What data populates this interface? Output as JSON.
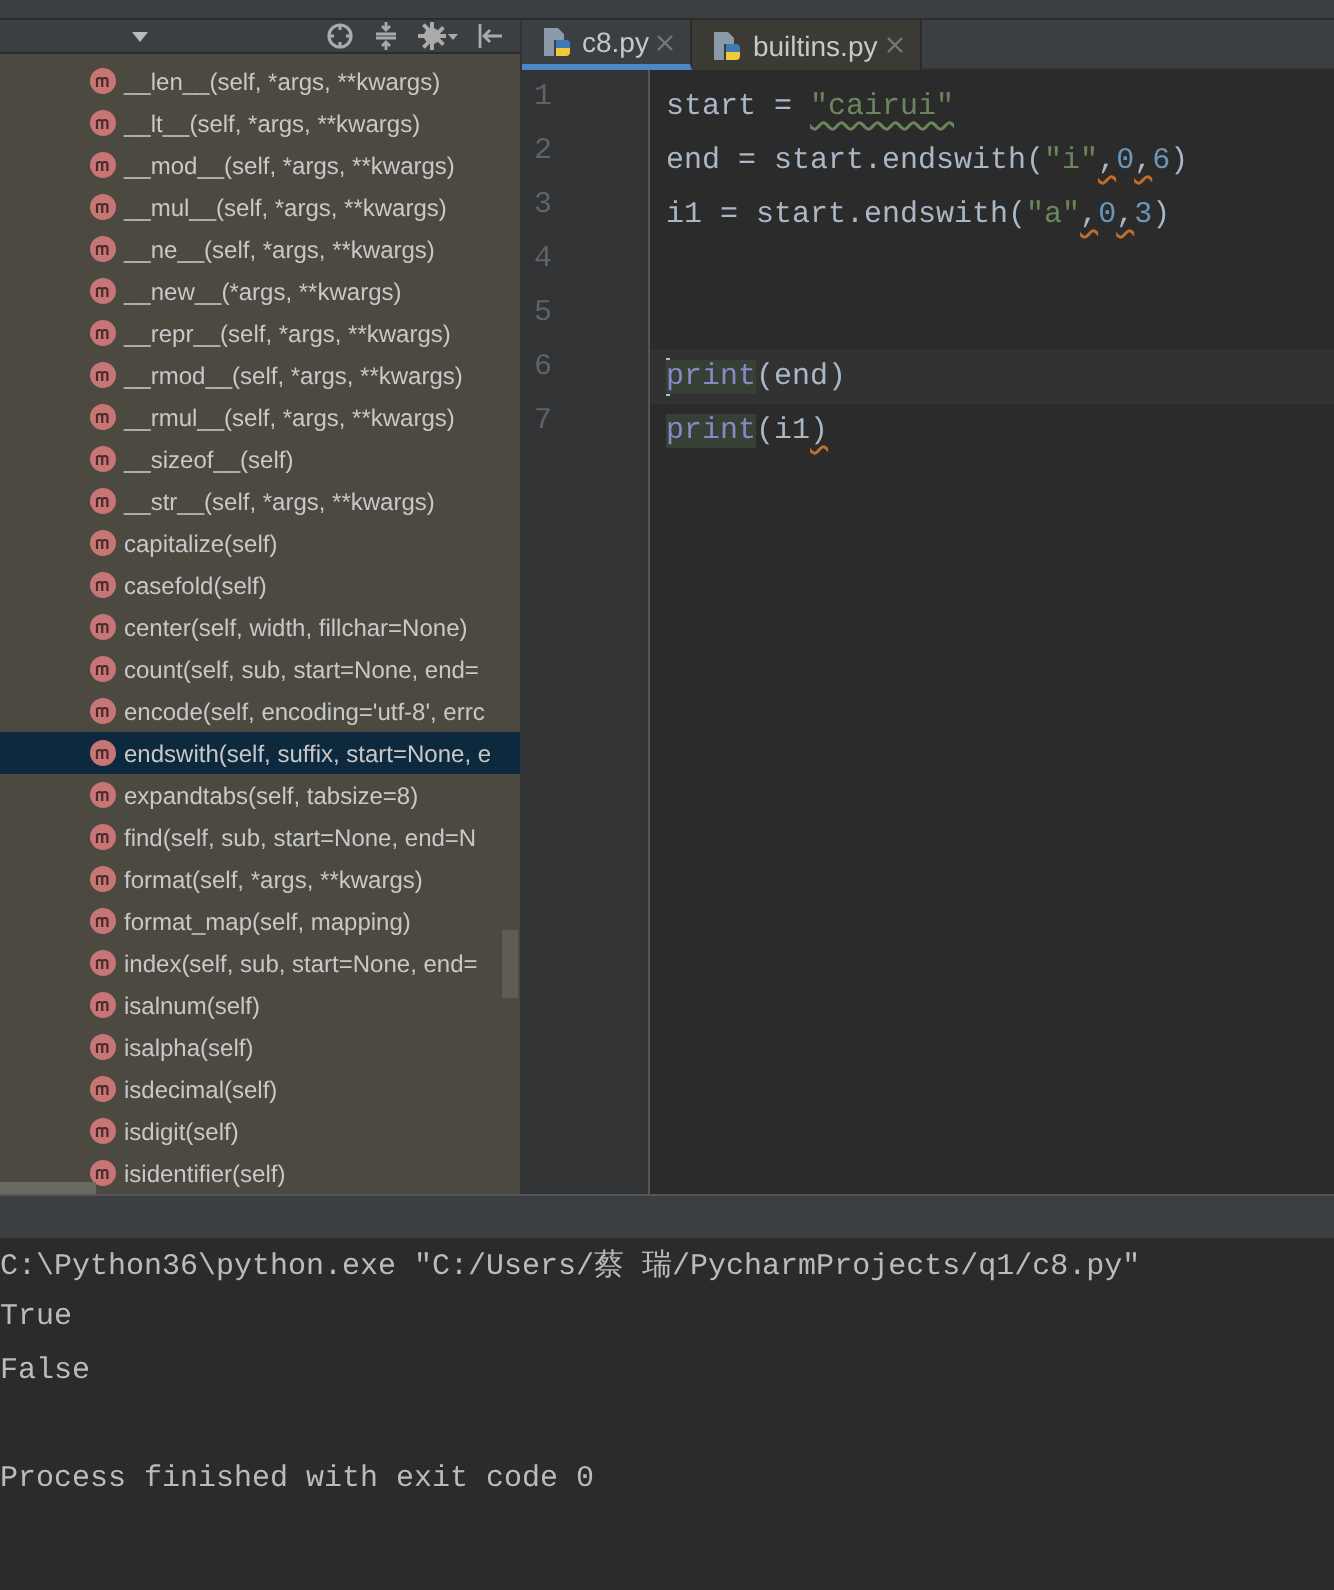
{
  "structure": {
    "methods": [
      {
        "label": "__len__(self, *args, **kwargs)",
        "selected": false
      },
      {
        "label": "__lt__(self, *args, **kwargs)",
        "selected": false
      },
      {
        "label": "__mod__(self, *args, **kwargs)",
        "selected": false
      },
      {
        "label": "__mul__(self, *args, **kwargs)",
        "selected": false
      },
      {
        "label": "__ne__(self, *args, **kwargs)",
        "selected": false
      },
      {
        "label": "__new__(*args, **kwargs)",
        "selected": false
      },
      {
        "label": "__repr__(self, *args, **kwargs)",
        "selected": false
      },
      {
        "label": "__rmod__(self, *args, **kwargs)",
        "selected": false
      },
      {
        "label": "__rmul__(self, *args, **kwargs)",
        "selected": false
      },
      {
        "label": "__sizeof__(self)",
        "selected": false
      },
      {
        "label": "__str__(self, *args, **kwargs)",
        "selected": false
      },
      {
        "label": "capitalize(self)",
        "selected": false
      },
      {
        "label": "casefold(self)",
        "selected": false
      },
      {
        "label": "center(self, width, fillchar=None)",
        "selected": false
      },
      {
        "label": "count(self, sub, start=None, end=",
        "selected": false
      },
      {
        "label": "encode(self, encoding='utf-8', errc",
        "selected": false
      },
      {
        "label": "endswith(self, suffix, start=None, e",
        "selected": true
      },
      {
        "label": "expandtabs(self, tabsize=8)",
        "selected": false
      },
      {
        "label": "find(self, sub, start=None, end=N",
        "selected": false
      },
      {
        "label": "format(self, *args, **kwargs)",
        "selected": false
      },
      {
        "label": "format_map(self, mapping)",
        "selected": false
      },
      {
        "label": "index(self, sub, start=None, end=",
        "selected": false
      },
      {
        "label": "isalnum(self)",
        "selected": false
      },
      {
        "label": "isalpha(self)",
        "selected": false
      },
      {
        "label": "isdecimal(self)",
        "selected": false
      },
      {
        "label": "isdigit(self)",
        "selected": false
      },
      {
        "label": "isidentifier(self)",
        "selected": false
      }
    ]
  },
  "tabs": [
    {
      "label": "c8.py",
      "selected": true
    },
    {
      "label": "builtins.py",
      "selected": false
    }
  ],
  "editor": {
    "lines": [
      {
        "number": "1",
        "current": false,
        "tokens": [
          {
            "text": "start = ",
            "kind": "plain",
            "warning": false
          },
          {
            "text": "\"cairui\"",
            "kind": "string",
            "warning": true
          }
        ]
      },
      {
        "number": "2",
        "current": false,
        "tokens": [
          {
            "text": "end = start.endswith(",
            "kind": "plain",
            "warning": false
          },
          {
            "text": "\"i\"",
            "kind": "string",
            "warning": false
          },
          {
            "text": ",",
            "kind": "plain",
            "warning": true
          },
          {
            "text": "0",
            "kind": "number",
            "warning": false
          },
          {
            "text": ",",
            "kind": "plain",
            "warning": true
          },
          {
            "text": "6",
            "kind": "number",
            "warning": false
          },
          {
            "text": ")",
            "kind": "plain",
            "warning": false
          }
        ]
      },
      {
        "number": "3",
        "current": false,
        "tokens": [
          {
            "text": "i1 = start.endswith(",
            "kind": "plain",
            "warning": false
          },
          {
            "text": "\"a\"",
            "kind": "string",
            "warning": false
          },
          {
            "text": ",",
            "kind": "plain",
            "warning": true
          },
          {
            "text": "0",
            "kind": "number",
            "warning": false
          },
          {
            "text": ",",
            "kind": "plain",
            "warning": true
          },
          {
            "text": "3",
            "kind": "number",
            "warning": false
          },
          {
            "text": ")",
            "kind": "plain",
            "warning": false
          }
        ]
      },
      {
        "number": "4",
        "current": false
      },
      {
        "number": "5",
        "current": false
      },
      {
        "number": "6",
        "current": true,
        "tokens": [
          {
            "text": "print",
            "kind": "builtin",
            "warning": false
          },
          {
            "text": "(end)",
            "kind": "plain",
            "warning": false
          }
        ]
      },
      {
        "number": "7",
        "current": false,
        "tokens": [
          {
            "text": "print",
            "kind": "builtin",
            "warning": false
          },
          {
            "text": "(i1",
            "kind": "plain",
            "warning": false
          },
          {
            "text": ")",
            "kind": "plain",
            "warning": true
          }
        ]
      }
    ]
  },
  "console": {
    "output": [
      "C:\\Python36\\python.exe \"C:/Users/蔡 瑞/PycharmProjects/q1/c8.py\"",
      "True",
      "False"
    ],
    "exit_message": "Process finished with exit code 0"
  }
}
